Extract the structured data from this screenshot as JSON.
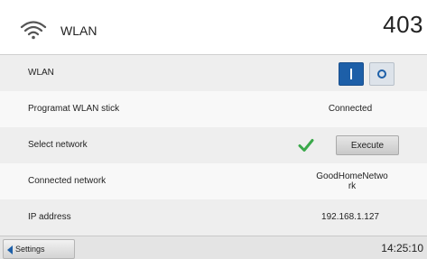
{
  "header": {
    "title": "WLAN",
    "program_code": "403",
    "icon": "wifi-icon"
  },
  "rows": [
    {
      "label": "WLAN",
      "control": "toggle",
      "toggle_on_symbol": "I",
      "toggle_off_symbol": "O",
      "state": "on"
    },
    {
      "label": "Programat WLAN stick",
      "value": "Connected"
    },
    {
      "label": "Select network",
      "status_icon": "check-icon",
      "button_label": "Execute"
    },
    {
      "label": "Connected network",
      "value": "GoodHomeNetwo rk"
    },
    {
      "label": "IP address",
      "value": "192.168.1.127"
    }
  ],
  "footer": {
    "back_label": "Settings",
    "time": "14:25:10"
  },
  "colors": {
    "accent_blue": "#1d5fa8",
    "check_green": "#3aa84a"
  }
}
